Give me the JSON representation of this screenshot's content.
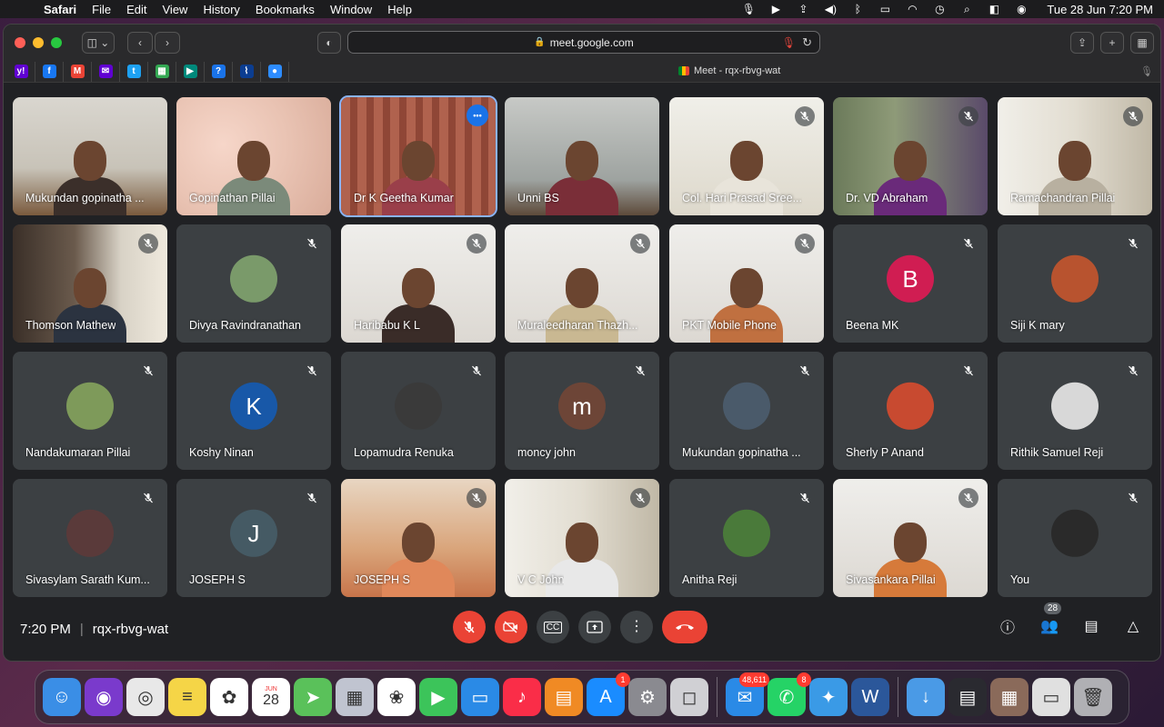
{
  "menubar": {
    "app": "Safari",
    "items": [
      "File",
      "Edit",
      "View",
      "History",
      "Bookmarks",
      "Window",
      "Help"
    ],
    "clock": "Tue 28 Jun  7:20 PM"
  },
  "browser": {
    "url": "meet.google.com",
    "tab_title": "Meet - rqx-rbvg-wat",
    "favorites": [
      {
        "icon": "yahoo-icon",
        "color": "#6001d2",
        "glyph": "y!"
      },
      {
        "icon": "facebook-icon",
        "color": "#1877f2",
        "glyph": "f"
      },
      {
        "icon": "gmail-icon",
        "color": "#ea4335",
        "glyph": "M"
      },
      {
        "icon": "yahoo-mail-icon",
        "color": "#6001d2",
        "glyph": "✉"
      },
      {
        "icon": "twitter-icon",
        "color": "#1da1f2",
        "glyph": "t"
      },
      {
        "icon": "calendar-icon",
        "color": "#34a853",
        "glyph": "▦"
      },
      {
        "icon": "meet-icon",
        "color": "#00897b",
        "glyph": "▶"
      },
      {
        "icon": "help-icon",
        "color": "#1a73e8",
        "glyph": "?"
      },
      {
        "icon": "chart-icon",
        "color": "#0b3d91",
        "glyph": "⌇"
      },
      {
        "icon": "zoom-icon",
        "color": "#2d8cff",
        "glyph": "●"
      }
    ]
  },
  "meet": {
    "time": "7:20 PM",
    "meeting_code": "rqx-rbvg-wat",
    "participant_count": "28",
    "tiles": [
      {
        "name": "Mukundan gopinatha ...",
        "kind": "video",
        "bg": "v-wall",
        "shirt": "#3b2f2a",
        "muted": false
      },
      {
        "name": "Gopinathan Pillai",
        "kind": "video",
        "bg": "v-pink",
        "shirt": "#7b8a7a",
        "muted": false
      },
      {
        "name": "Dr K Geetha Kumar",
        "kind": "video",
        "bg": "v-curtain",
        "shirt": "#9a3f4a",
        "muted": false,
        "active": true
      },
      {
        "name": "Unni BS",
        "kind": "video",
        "bg": "v-room",
        "shirt": "#7a2e38",
        "muted": false
      },
      {
        "name": "Col. Hari Prasad Sree...",
        "kind": "video",
        "bg": "v-bright",
        "shirt": "#e8e4da",
        "muted": true
      },
      {
        "name": "Dr. VD Abraham",
        "kind": "video",
        "bg": "v-green",
        "shirt": "#6a2a7a",
        "muted": true
      },
      {
        "name": "Ramachandran Pillai",
        "kind": "video",
        "bg": "v-office",
        "shirt": "#b8b0a0",
        "muted": true
      },
      {
        "name": "Thomson Mathew",
        "kind": "video",
        "bg": "v-shelf",
        "shirt": "#2b3340",
        "muted": true
      },
      {
        "name": "Divya Ravindranathan",
        "kind": "avatar",
        "avatar_color": "#7a9a6a",
        "letter": "",
        "muted": true
      },
      {
        "name": "Haribabu K L",
        "kind": "video",
        "bg": "v-pale",
        "shirt": "#3a2c28",
        "muted": true
      },
      {
        "name": "Muraleedharan Thazh...",
        "kind": "video",
        "bg": "v-pale",
        "shirt": "#c9b892",
        "muted": true
      },
      {
        "name": "PKT Mobile Phone",
        "kind": "video",
        "bg": "v-pale",
        "shirt": "#c07040",
        "muted": true
      },
      {
        "name": "Beena MK",
        "kind": "avatar",
        "avatar_color": "#d01d52",
        "letter": "B",
        "muted": true
      },
      {
        "name": "Siji K mary",
        "kind": "avatar",
        "avatar_color": "#b8532f",
        "letter": "",
        "muted": true
      },
      {
        "name": "Nandakumaran Pillai",
        "kind": "avatar",
        "avatar_color": "#7e9a5a",
        "letter": "",
        "muted": true
      },
      {
        "name": "Koshy Ninan",
        "kind": "avatar",
        "avatar_color": "#1858a8",
        "letter": "K",
        "muted": true
      },
      {
        "name": "Lopamudra Renuka",
        "kind": "avatar",
        "avatar_color": "#3a3a3a",
        "letter": "",
        "muted": true
      },
      {
        "name": "moncy john",
        "kind": "avatar",
        "avatar_color": "#6d4537",
        "letter": "m",
        "muted": true
      },
      {
        "name": "Mukundan gopinatha ...",
        "kind": "avatar",
        "avatar_color": "#4a5a6a",
        "letter": "",
        "muted": true
      },
      {
        "name": "Sherly P Anand",
        "kind": "avatar",
        "avatar_color": "#c84a30",
        "letter": "",
        "muted": true
      },
      {
        "name": "Rithik Samuel Reji",
        "kind": "avatar",
        "avatar_color": "#d8d8d8",
        "letter": "",
        "muted": true
      },
      {
        "name": "Sivasylam Sarath Kum...",
        "kind": "avatar",
        "avatar_color": "#5a3a3a",
        "letter": "",
        "muted": true
      },
      {
        "name": "JOSEPH S",
        "kind": "avatar",
        "avatar_color": "#455a64",
        "letter": "J",
        "muted": true
      },
      {
        "name": "JOSEPH S",
        "kind": "video",
        "bg": "v-orange",
        "shirt": "#e0885a",
        "muted": true
      },
      {
        "name": "V C John",
        "kind": "video",
        "bg": "v-office",
        "shirt": "#e8e8e8",
        "muted": true
      },
      {
        "name": "Anitha Reji",
        "kind": "avatar",
        "avatar_color": "#4a7a3a",
        "letter": "",
        "muted": true
      },
      {
        "name": "Sivasankara Pillai",
        "kind": "video",
        "bg": "v-pale",
        "shirt": "#d67a3a",
        "muted": true
      },
      {
        "name": "You",
        "kind": "avatar",
        "avatar_color": "#2a2a2a",
        "letter": "",
        "muted": true
      }
    ]
  },
  "dock": {
    "apps": [
      {
        "icon": "finder-icon",
        "color": "#3a8ee6",
        "glyph": "☺"
      },
      {
        "icon": "siri-icon",
        "color": "#7a3acc",
        "glyph": "◉"
      },
      {
        "icon": "chrome-icon",
        "color": "#e8e8e8",
        "glyph": "◎"
      },
      {
        "icon": "notes-icon",
        "color": "#f5d547",
        "glyph": "≡"
      },
      {
        "icon": "photos-app-icon",
        "color": "#ffffff",
        "glyph": "✿"
      },
      {
        "icon": "calendar-app-icon",
        "color": "#ffffff",
        "glyph": "28",
        "sub": "JUN"
      },
      {
        "icon": "maps-icon",
        "color": "#5ac15a",
        "glyph": "➤"
      },
      {
        "icon": "launchpad-icon",
        "color": "#c0c4d0",
        "glyph": "▦"
      },
      {
        "icon": "photos-icon",
        "color": "#ffffff",
        "glyph": "❀"
      },
      {
        "icon": "facetime-icon",
        "color": "#3cc45a",
        "glyph": "▶"
      },
      {
        "icon": "keynote-icon",
        "color": "#2a8ae6",
        "glyph": "▭"
      },
      {
        "icon": "music-icon",
        "color": "#fa2d48",
        "glyph": "♪"
      },
      {
        "icon": "books-icon",
        "color": "#f08a24",
        "glyph": "▤"
      },
      {
        "icon": "app-store-icon",
        "color": "#1a8cff",
        "glyph": "A",
        "badge": "1"
      },
      {
        "icon": "settings-icon",
        "color": "#8a8a90",
        "glyph": "⚙"
      },
      {
        "icon": "screenshot-icon",
        "color": "#d0d0d4",
        "glyph": "◻"
      },
      {
        "sep": true
      },
      {
        "icon": "mail-icon",
        "color": "#2a8ae6",
        "glyph": "✉",
        "badge": "48,611"
      },
      {
        "icon": "whatsapp-icon",
        "color": "#25d366",
        "glyph": "✆",
        "badge": "8"
      },
      {
        "icon": "safari-icon",
        "color": "#3a9ae6",
        "glyph": "✦"
      },
      {
        "icon": "word-icon",
        "color": "#2b579a",
        "glyph": "W"
      },
      {
        "sep": true
      },
      {
        "icon": "downloads-icon",
        "color": "#4a9ae6",
        "glyph": "↓"
      },
      {
        "icon": "window-thumb-icon",
        "color": "#2a2a30",
        "glyph": "▤"
      },
      {
        "icon": "window-thumb-icon",
        "color": "#8a6a5a",
        "glyph": "▦"
      },
      {
        "icon": "window-thumb-icon",
        "color": "#e0e0e0",
        "glyph": "▭"
      },
      {
        "icon": "trash-icon",
        "color": "#b0b0b4",
        "glyph": "🗑"
      }
    ]
  }
}
